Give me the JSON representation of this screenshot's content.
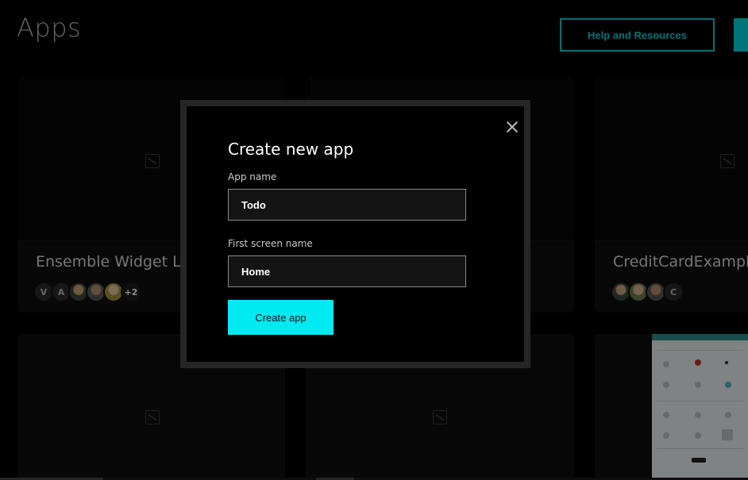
{
  "page": {
    "title": "Apps",
    "help_button_label": "Help and Resources"
  },
  "cards": [
    {
      "name": "Ensemble Widget L",
      "avatars": [
        "V",
        "A",
        "",
        "",
        "",
        "+2"
      ]
    },
    {
      "name": "",
      "avatars": []
    },
    {
      "name": "CreditCardExample",
      "avatars": [
        "",
        "",
        "",
        "C"
      ]
    }
  ],
  "modal": {
    "title": "Create new app",
    "app_name_label": "App name",
    "app_name_value": "Todo",
    "screen_name_label": "First screen name",
    "screen_name_value": "Home",
    "submit_label": "Create app"
  },
  "colors": {
    "accent": "#00eaf2",
    "background": "#000000",
    "modal_border": "#262626"
  },
  "icons": {
    "close": "close-icon",
    "thumbnail_placeholder": "image-placeholder-icon"
  }
}
